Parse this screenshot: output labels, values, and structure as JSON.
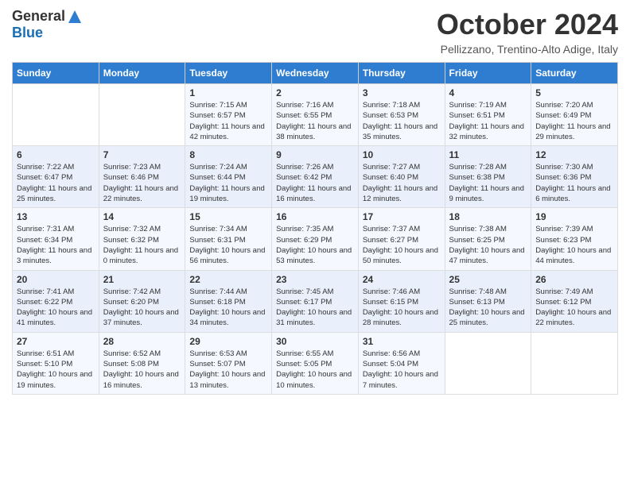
{
  "logo": {
    "general": "General",
    "blue": "Blue"
  },
  "header": {
    "month": "October 2024",
    "location": "Pellizzano, Trentino-Alto Adige, Italy"
  },
  "weekdays": [
    "Sunday",
    "Monday",
    "Tuesday",
    "Wednesday",
    "Thursday",
    "Friday",
    "Saturday"
  ],
  "weeks": [
    {
      "days": [
        {
          "num": "",
          "info": ""
        },
        {
          "num": "",
          "info": ""
        },
        {
          "num": "1",
          "info": "Sunrise: 7:15 AM\nSunset: 6:57 PM\nDaylight: 11 hours and 42 minutes."
        },
        {
          "num": "2",
          "info": "Sunrise: 7:16 AM\nSunset: 6:55 PM\nDaylight: 11 hours and 38 minutes."
        },
        {
          "num": "3",
          "info": "Sunrise: 7:18 AM\nSunset: 6:53 PM\nDaylight: 11 hours and 35 minutes."
        },
        {
          "num": "4",
          "info": "Sunrise: 7:19 AM\nSunset: 6:51 PM\nDaylight: 11 hours and 32 minutes."
        },
        {
          "num": "5",
          "info": "Sunrise: 7:20 AM\nSunset: 6:49 PM\nDaylight: 11 hours and 29 minutes."
        }
      ]
    },
    {
      "days": [
        {
          "num": "6",
          "info": "Sunrise: 7:22 AM\nSunset: 6:47 PM\nDaylight: 11 hours and 25 minutes."
        },
        {
          "num": "7",
          "info": "Sunrise: 7:23 AM\nSunset: 6:46 PM\nDaylight: 11 hours and 22 minutes."
        },
        {
          "num": "8",
          "info": "Sunrise: 7:24 AM\nSunset: 6:44 PM\nDaylight: 11 hours and 19 minutes."
        },
        {
          "num": "9",
          "info": "Sunrise: 7:26 AM\nSunset: 6:42 PM\nDaylight: 11 hours and 16 minutes."
        },
        {
          "num": "10",
          "info": "Sunrise: 7:27 AM\nSunset: 6:40 PM\nDaylight: 11 hours and 12 minutes."
        },
        {
          "num": "11",
          "info": "Sunrise: 7:28 AM\nSunset: 6:38 PM\nDaylight: 11 hours and 9 minutes."
        },
        {
          "num": "12",
          "info": "Sunrise: 7:30 AM\nSunset: 6:36 PM\nDaylight: 11 hours and 6 minutes."
        }
      ]
    },
    {
      "days": [
        {
          "num": "13",
          "info": "Sunrise: 7:31 AM\nSunset: 6:34 PM\nDaylight: 11 hours and 3 minutes."
        },
        {
          "num": "14",
          "info": "Sunrise: 7:32 AM\nSunset: 6:32 PM\nDaylight: 11 hours and 0 minutes."
        },
        {
          "num": "15",
          "info": "Sunrise: 7:34 AM\nSunset: 6:31 PM\nDaylight: 10 hours and 56 minutes."
        },
        {
          "num": "16",
          "info": "Sunrise: 7:35 AM\nSunset: 6:29 PM\nDaylight: 10 hours and 53 minutes."
        },
        {
          "num": "17",
          "info": "Sunrise: 7:37 AM\nSunset: 6:27 PM\nDaylight: 10 hours and 50 minutes."
        },
        {
          "num": "18",
          "info": "Sunrise: 7:38 AM\nSunset: 6:25 PM\nDaylight: 10 hours and 47 minutes."
        },
        {
          "num": "19",
          "info": "Sunrise: 7:39 AM\nSunset: 6:23 PM\nDaylight: 10 hours and 44 minutes."
        }
      ]
    },
    {
      "days": [
        {
          "num": "20",
          "info": "Sunrise: 7:41 AM\nSunset: 6:22 PM\nDaylight: 10 hours and 41 minutes."
        },
        {
          "num": "21",
          "info": "Sunrise: 7:42 AM\nSunset: 6:20 PM\nDaylight: 10 hours and 37 minutes."
        },
        {
          "num": "22",
          "info": "Sunrise: 7:44 AM\nSunset: 6:18 PM\nDaylight: 10 hours and 34 minutes."
        },
        {
          "num": "23",
          "info": "Sunrise: 7:45 AM\nSunset: 6:17 PM\nDaylight: 10 hours and 31 minutes."
        },
        {
          "num": "24",
          "info": "Sunrise: 7:46 AM\nSunset: 6:15 PM\nDaylight: 10 hours and 28 minutes."
        },
        {
          "num": "25",
          "info": "Sunrise: 7:48 AM\nSunset: 6:13 PM\nDaylight: 10 hours and 25 minutes."
        },
        {
          "num": "26",
          "info": "Sunrise: 7:49 AM\nSunset: 6:12 PM\nDaylight: 10 hours and 22 minutes."
        }
      ]
    },
    {
      "days": [
        {
          "num": "27",
          "info": "Sunrise: 6:51 AM\nSunset: 5:10 PM\nDaylight: 10 hours and 19 minutes."
        },
        {
          "num": "28",
          "info": "Sunrise: 6:52 AM\nSunset: 5:08 PM\nDaylight: 10 hours and 16 minutes."
        },
        {
          "num": "29",
          "info": "Sunrise: 6:53 AM\nSunset: 5:07 PM\nDaylight: 10 hours and 13 minutes."
        },
        {
          "num": "30",
          "info": "Sunrise: 6:55 AM\nSunset: 5:05 PM\nDaylight: 10 hours and 10 minutes."
        },
        {
          "num": "31",
          "info": "Sunrise: 6:56 AM\nSunset: 5:04 PM\nDaylight: 10 hours and 7 minutes."
        },
        {
          "num": "",
          "info": ""
        },
        {
          "num": "",
          "info": ""
        }
      ]
    }
  ]
}
